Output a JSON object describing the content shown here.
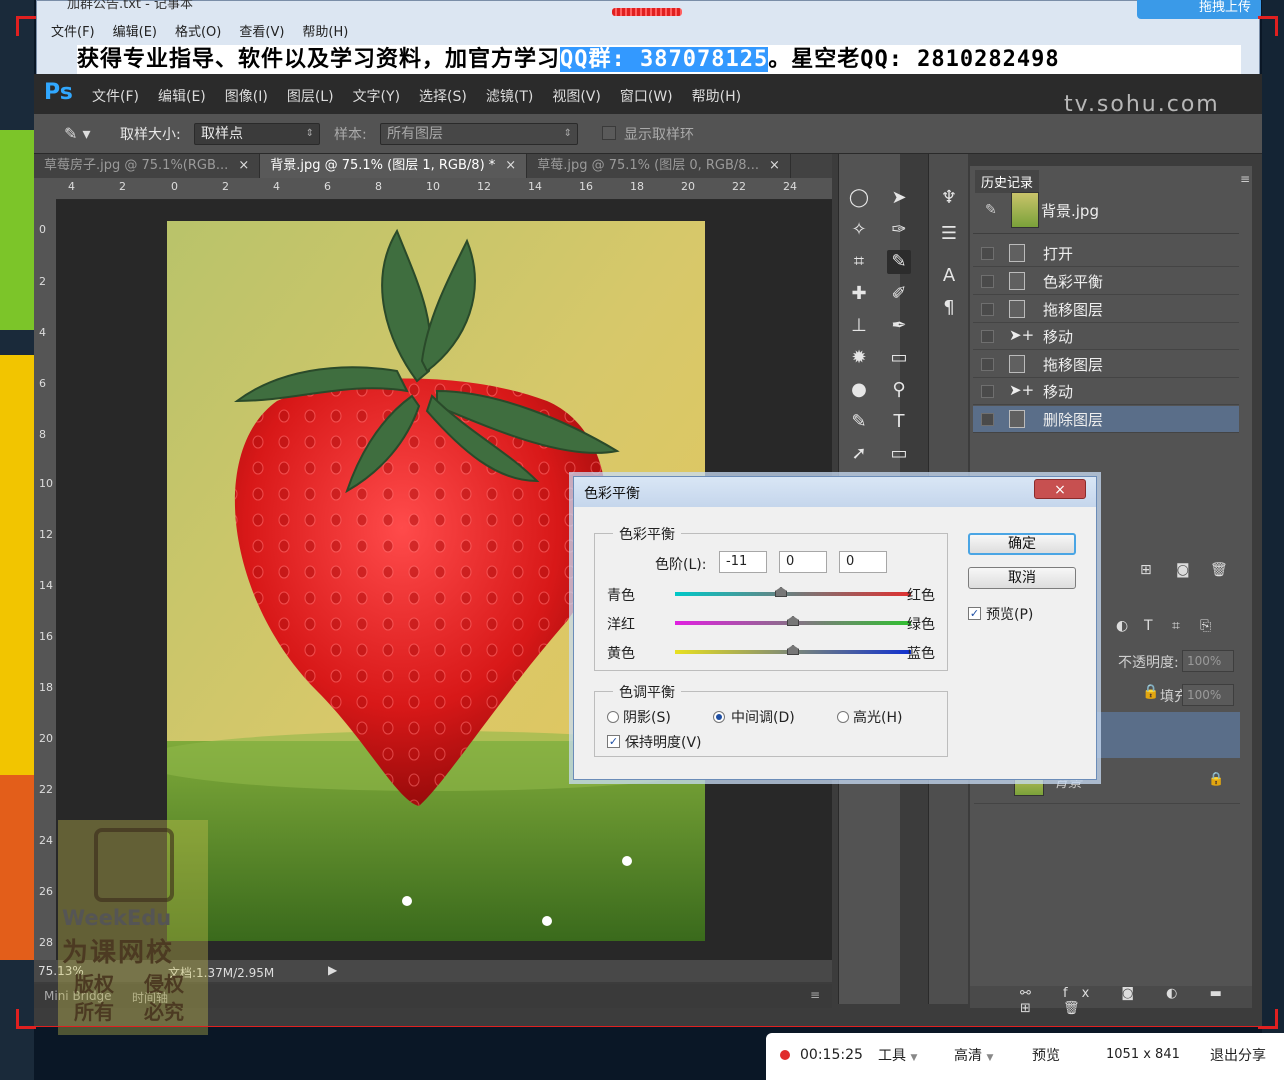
{
  "notepad": {
    "title": "加群公告.txt - 记事本",
    "menu": [
      "文件(F)",
      "编辑(E)",
      "格式(O)",
      "查看(V)",
      "帮助(H)"
    ],
    "text_before": "获得专业指导、软件以及学习资料，加官方学习",
    "text_highlight": "QQ群: 387078125",
    "text_after": "。星空老QQ: 2810282498",
    "upload_label": "拖拽上传"
  },
  "ps": {
    "logo": "Ps",
    "menu": [
      "文件(F)",
      "编辑(E)",
      "图像(I)",
      "图层(L)",
      "文字(Y)",
      "选择(S)",
      "滤镜(T)",
      "视图(V)",
      "窗口(W)",
      "帮助(H)"
    ],
    "watermark": "tv.sohu.com",
    "options": {
      "sample_size_label": "取样大小:",
      "sample_size_value": "取样点",
      "sample_label": "样本:",
      "sample_value": "所有图层",
      "show_ring_label": "显示取样环"
    },
    "tabs": [
      {
        "label": "草莓房子.jpg @ 75.1%(RGB...",
        "close": "×",
        "active": false
      },
      {
        "label": "背景.jpg @ 75.1% (图层 1, RGB/8) *",
        "close": "×",
        "active": true
      },
      {
        "label": "草莓.jpg @ 75.1% (图层 0, RGB/8...",
        "close": "×",
        "active": false
      }
    ],
    "ruler_top": [
      "4",
      "2",
      "0",
      "2",
      "4",
      "6",
      "8",
      "10",
      "12",
      "14",
      "16",
      "18",
      "20",
      "22",
      "24"
    ],
    "ruler_left": [
      "0",
      "2",
      "4",
      "6",
      "8",
      "10",
      "12",
      "14",
      "16",
      "18",
      "20",
      "22",
      "24",
      "26",
      "28"
    ],
    "status": {
      "zoom": "75.13%",
      "doc": "文档:1.37M/2.95M"
    },
    "minibridge": {
      "left": "Mini Bridge",
      "right": "时间轴"
    }
  },
  "history": {
    "tab": "历史记录",
    "snapshot": "背景.jpg",
    "items": [
      "打开",
      "色彩平衡",
      "拖移图层",
      "移动",
      "拖移图层",
      "移动",
      "删除图层"
    ],
    "selected_index": 6
  },
  "layers": {
    "opacity_label": "不透明度:",
    "opacity_value": "100%",
    "fill_label": "填充:",
    "fill_value": "100%",
    "bottom_layer": "背景"
  },
  "dialog": {
    "title": "色彩平衡",
    "close": "×",
    "group1": "色彩平衡",
    "levels_label": "色阶(L):",
    "levels": [
      "-11",
      "0",
      "0"
    ],
    "sliders": [
      {
        "left": "青色",
        "right": "红色",
        "value": -11
      },
      {
        "left": "洋红",
        "right": "绿色",
        "value": 0
      },
      {
        "left": "黄色",
        "right": "蓝色",
        "value": 0
      }
    ],
    "group2": "色调平衡",
    "tones": [
      "阴影(S)",
      "中间调(D)",
      "高光(H)"
    ],
    "tone_selected": 1,
    "preserve_label": "保持明度(V)",
    "preserve_checked": true,
    "ok": "确定",
    "cancel": "取消",
    "preview_label": "预览(P)",
    "preview_checked": true
  },
  "watermark": {
    "brand": "WeekEdu",
    "cn": "为课网校",
    "rights1": "版权",
    "rights2": "侵权",
    "rights3": "所有",
    "rights4": "必究"
  },
  "recbar": {
    "time": "00:15:25",
    "tools": "工具",
    "quality": "高清",
    "preview": "预览",
    "resolution": "1051 x 841",
    "exit": "退出分享"
  }
}
